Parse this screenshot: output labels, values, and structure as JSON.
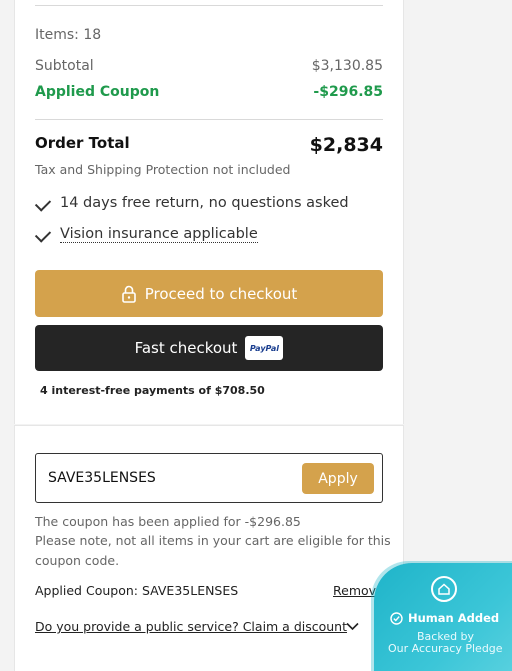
{
  "summary": {
    "items_label": "Items: 18",
    "subtotal_label": "Subtotal",
    "subtotal_value": "$3,130.85",
    "coupon_label": "Applied Coupon",
    "coupon_value": "-$296.85",
    "order_total_label": "Order Total",
    "order_total_value": "$2,834",
    "tax_note": "Tax and Shipping Protection not included"
  },
  "benefits": [
    {
      "text": "14 days free return, no questions asked"
    },
    {
      "text": "Vision insurance applicable"
    }
  ],
  "buttons": {
    "checkout_label": "Proceed to checkout",
    "fast_checkout_label": "Fast checkout",
    "paypal_text": "PayPal"
  },
  "installments": "4 interest-free payments of $708.50",
  "coupon": {
    "code_value": "SAVE35LENSES",
    "apply_label": "Apply",
    "applied_msg": "The coupon has been applied for -$296.85",
    "note_line1": "Please note, not all items in your cart are eligible for this",
    "note_line2": "coupon code.",
    "applied_coupon_text": "Applied Coupon: SAVE35LENSES",
    "remove_label": "Remove",
    "public_service_link": "Do you provide a public service? Claim a discount"
  },
  "accuracy_badge": {
    "line1": "Human Added",
    "line2": "Backed by",
    "line3": "Our Accuracy Pledge"
  },
  "colors": {
    "accent": "#d4a24c",
    "discount": "#1f9a4c",
    "dark_button": "#252525",
    "badge": "#3cc6d8"
  }
}
